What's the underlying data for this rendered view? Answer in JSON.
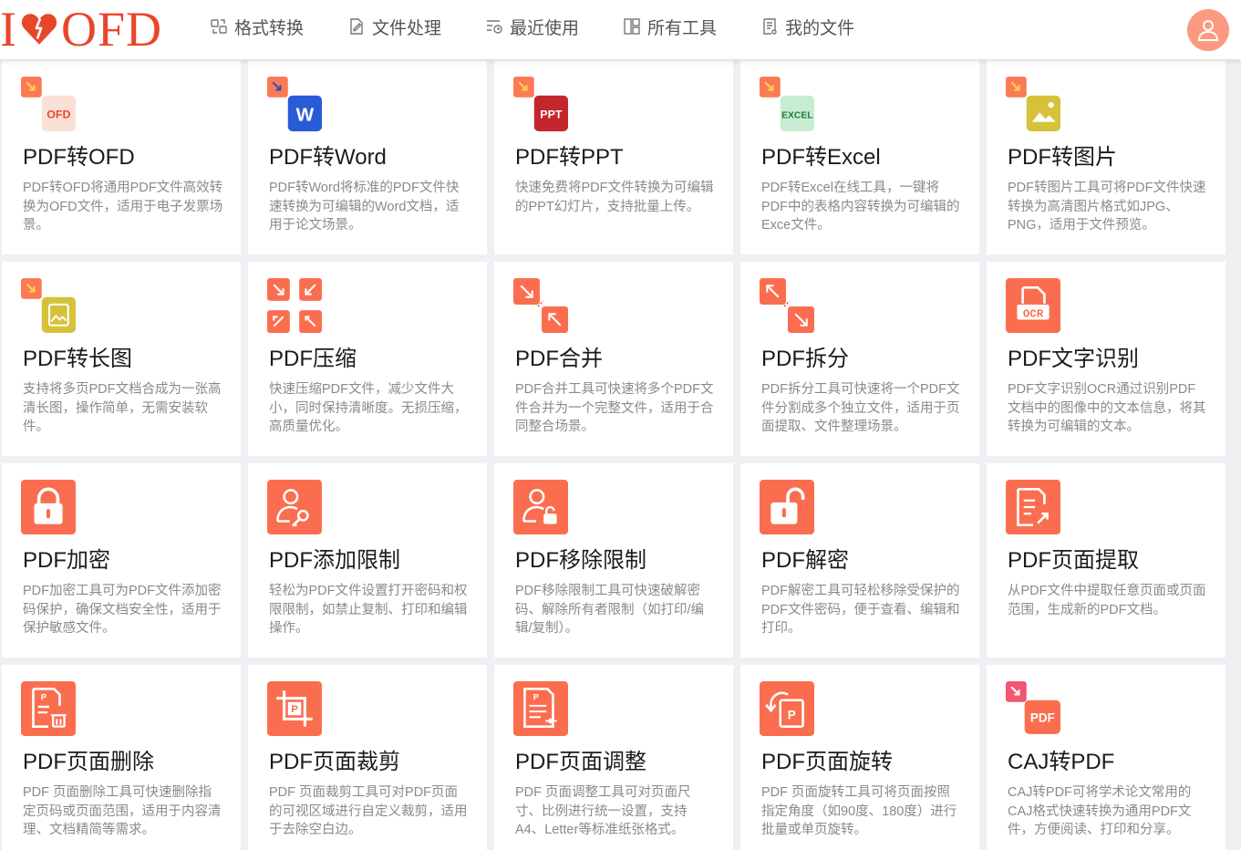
{
  "header": {
    "logo": {
      "left": "I",
      "right": "OFD"
    },
    "nav": [
      {
        "label": "格式转换",
        "icon": "convert-icon"
      },
      {
        "label": "文件处理",
        "icon": "edit-file-icon"
      },
      {
        "label": "最近使用",
        "icon": "recent-icon"
      },
      {
        "label": "所有工具",
        "icon": "grid-icon"
      },
      {
        "label": "我的文件",
        "icon": "my-files-icon"
      }
    ]
  },
  "colors": {
    "brand": "#e8462a",
    "accent": "#fa6e4f",
    "avatar": "#fb9a80"
  },
  "tools": [
    {
      "id": "pdf-to-ofd",
      "icon": "ofd-convert-icon",
      "badge": "OFD",
      "title": "PDF转OFD",
      "desc": "PDF转OFD将通用PDF文件高效转换为OFD文件，适用于电子发票场景。"
    },
    {
      "id": "pdf-to-word",
      "icon": "word-convert-icon",
      "badge": "W",
      "title": "PDF转Word",
      "desc": "PDF转Word将标准的PDF文件快速转换为可编辑的Word文档，适用于论文场景。"
    },
    {
      "id": "pdf-to-ppt",
      "icon": "ppt-convert-icon",
      "badge": "PPT",
      "title": "PDF转PPT",
      "desc": "快速免费将PDF文件转换为可编辑的PPT幻灯片，支持批量上传。"
    },
    {
      "id": "pdf-to-excel",
      "icon": "excel-convert-icon",
      "badge": "EXCEL",
      "title": "PDF转Excel",
      "desc": "PDF转Excel在线工具，一键将PDF中的表格内容转换为可编辑的Exce文件。"
    },
    {
      "id": "pdf-to-image",
      "icon": "image-convert-icon",
      "badge": "",
      "title": "PDF转图片",
      "desc": "PDF转图片工具可将PDF文件快速转换为高清图片格式如JPG、PNG，适用于文件预览。"
    },
    {
      "id": "pdf-to-long-image",
      "icon": "long-image-convert-icon",
      "badge": "",
      "title": "PDF转长图",
      "desc": "支持将多页PDF文档合成为一张高清长图，操作简单，无需安装软件。"
    },
    {
      "id": "pdf-compress",
      "icon": "compress-icon",
      "badge": "",
      "title": "PDF压缩",
      "desc": "快速压缩PDF文件，减少文件大小，同时保持清晰度。无损压缩，高质量优化。"
    },
    {
      "id": "pdf-merge",
      "icon": "merge-icon",
      "badge": "",
      "title": "PDF合并",
      "desc": "PDF合并工具可快速将多个PDF文件合并为一个完整文件，适用于合同整合场景。"
    },
    {
      "id": "pdf-split",
      "icon": "split-icon",
      "badge": "",
      "title": "PDF拆分",
      "desc": "PDF拆分工具可快速将一个PDF文件分割成多个独立文件，适用于页面提取、文件整理场景。"
    },
    {
      "id": "pdf-ocr",
      "icon": "ocr-icon",
      "badge": "OCR",
      "title": "PDF文字识别",
      "desc": "PDF文字识别OCR通过识别PDF文档中的图像中的文本信息，将其转换为可编辑的文本。"
    },
    {
      "id": "pdf-encrypt",
      "icon": "lock-icon",
      "badge": "",
      "title": "PDF加密",
      "desc": "PDF加密工具可为PDF文件添加密码保护，确保文档安全性，适用于保护敏感文件。"
    },
    {
      "id": "pdf-add-restriction",
      "icon": "user-key-icon",
      "badge": "",
      "title": "PDF添加限制",
      "desc": "轻松为PDF文件设置打开密码和权限限制，如禁止复制、打印和编辑操作。"
    },
    {
      "id": "pdf-remove-restriction",
      "icon": "user-unlock-icon",
      "badge": "",
      "title": "PDF移除限制",
      "desc": "PDF移除限制工具可快速破解密码、解除所有者限制（如打印/编辑/复制）。"
    },
    {
      "id": "pdf-decrypt",
      "icon": "unlock-icon",
      "badge": "",
      "title": "PDF解密",
      "desc": "PDF解密工具可轻松移除受保护的PDF文件密码，便于查看、编辑和打印。"
    },
    {
      "id": "pdf-page-extract",
      "icon": "page-extract-icon",
      "badge": "",
      "title": "PDF页面提取",
      "desc": "从PDF文件中提取任意页面或页面范围，生成新的PDF文档。"
    },
    {
      "id": "pdf-page-delete",
      "icon": "page-delete-icon",
      "badge": "P",
      "title": "PDF页面删除",
      "desc": "PDF 页面删除工具可快速删除指定页码或页面范围，适用于内容清理、文档精简等需求。"
    },
    {
      "id": "pdf-page-crop",
      "icon": "crop-icon",
      "badge": "P",
      "title": "PDF页面裁剪",
      "desc": "PDF 页面裁剪工具可对PDF页面的可视区域进行自定义裁剪，适用于去除空白边。"
    },
    {
      "id": "pdf-page-adjust",
      "icon": "page-adjust-icon",
      "badge": "P",
      "title": "PDF页面调整",
      "desc": "PDF 页面调整工具可对页面尺寸、比例进行统一设置，支持A4、Letter等标准纸张格式。"
    },
    {
      "id": "pdf-page-rotate",
      "icon": "rotate-icon",
      "badge": "P",
      "title": "PDF页面旋转",
      "desc": "PDF 页面旋转工具可将页面按照指定角度（如90度、180度）进行批量或单页旋转。"
    },
    {
      "id": "caj-to-pdf",
      "icon": "caj-convert-icon",
      "badge": "PDF",
      "title": "CAJ转PDF",
      "desc": "CAJ转PDF可将学术论文常用的CAJ格式快速转换为通用PDF文件，方便阅读、打印和分享。"
    }
  ]
}
